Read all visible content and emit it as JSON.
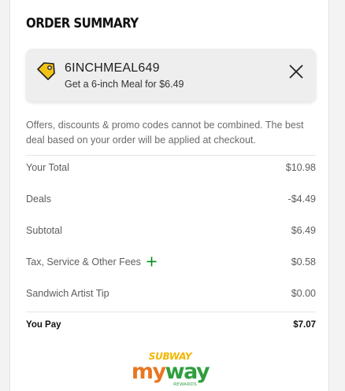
{
  "summary": {
    "title": "ORDER SUMMARY"
  },
  "promo": {
    "icon": "tag-icon",
    "code": "6INCHMEAL649",
    "description": "Get a 6-inch Meal for $6.49",
    "remove_icon": "close-icon"
  },
  "notice": "Offers, discounts & promo codes cannot be combined. The best deal based on your order will be applied at checkout.",
  "rows": [
    {
      "label": "Your Total",
      "value": "$10.98"
    },
    {
      "label": "Deals",
      "value": "-$4.49"
    },
    {
      "label": "Subtotal",
      "value": "$6.49"
    },
    {
      "label": "Tax, Service & Other Fees",
      "value": "$0.58",
      "expand_icon": "plus-icon"
    },
    {
      "label": "Sandwich Artist Tip",
      "value": "$0.00"
    }
  ],
  "total": {
    "label": "You Pay",
    "value": "$7.07"
  },
  "logo": {
    "brand": "SUBWAY",
    "program": "myway",
    "sub": "REWARDS"
  },
  "colors": {
    "tag_yellow": "#f2c315",
    "green": "#008c15",
    "subway_yellow": "#f2b700",
    "myway_orange": "#e87722",
    "myway_green": "#2e9e3e"
  }
}
